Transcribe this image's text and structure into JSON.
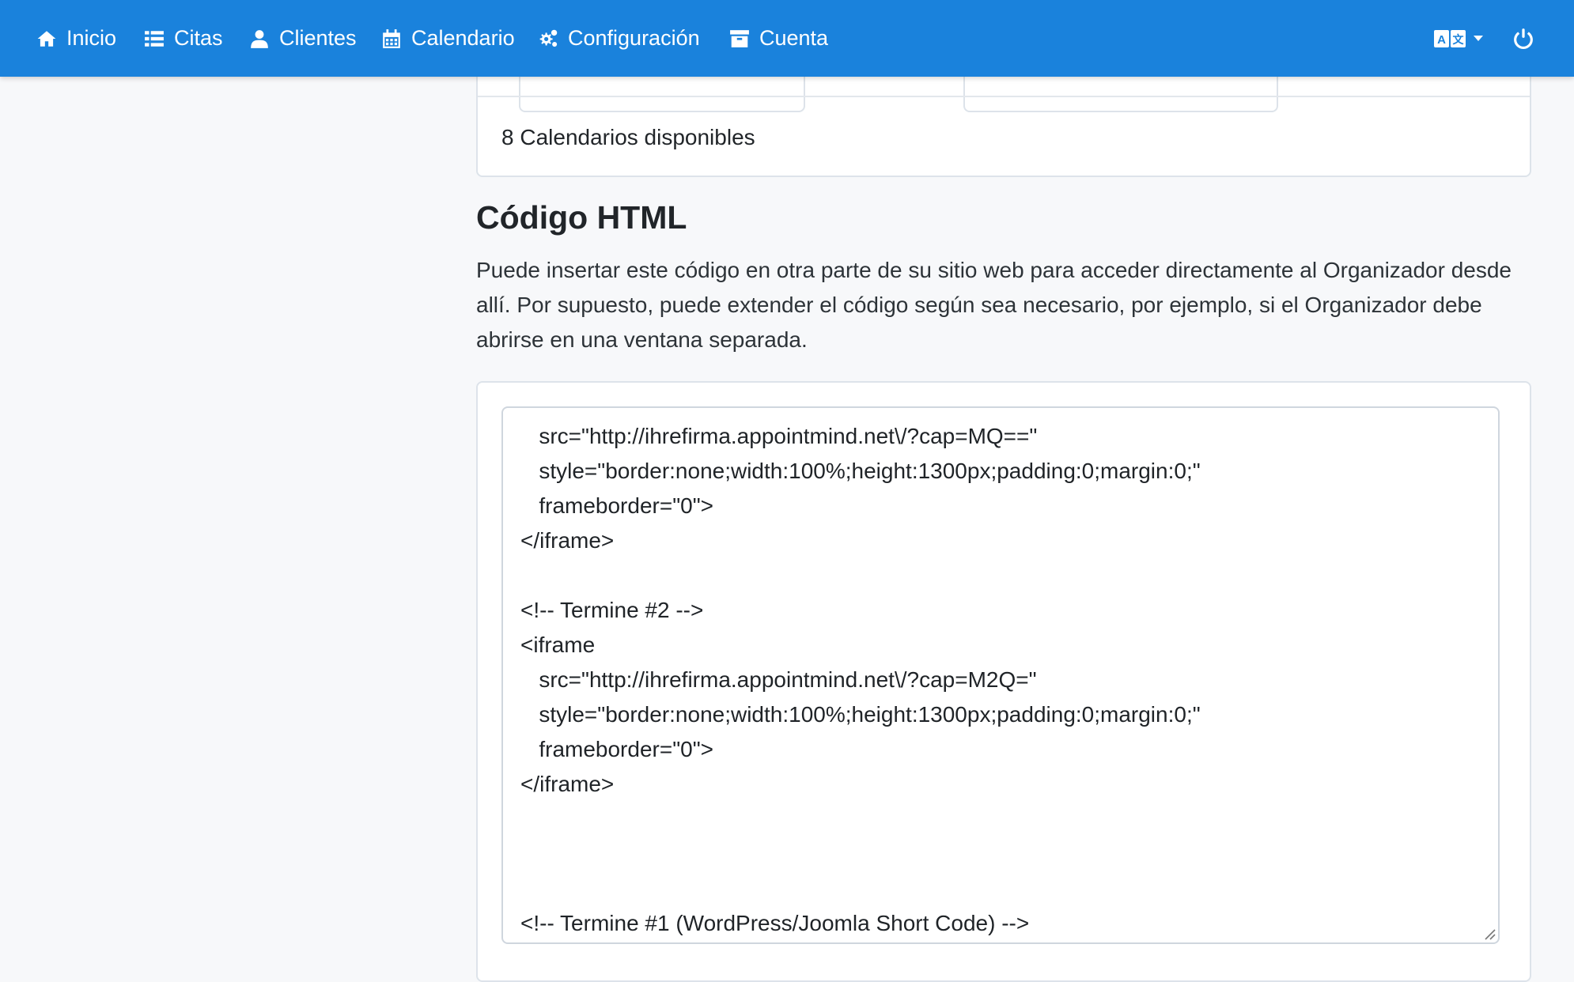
{
  "nav": {
    "items": [
      {
        "label": "Inicio",
        "icon": "home-icon"
      },
      {
        "label": "Citas",
        "icon": "list-icon"
      },
      {
        "label": "Clientes",
        "icon": "user-icon"
      },
      {
        "label": "Calendario",
        "icon": "calendar-icon"
      },
      {
        "label": "Configuración",
        "icon": "gears-icon"
      },
      {
        "label": "Cuenta",
        "icon": "archive-icon"
      }
    ],
    "language_icon": "language-icon",
    "power_icon": "power-icon"
  },
  "calendars": {
    "footer": "8 Calendarios disponibles"
  },
  "html_code": {
    "title": "Código HTML",
    "description": "Puede insertar este código en otra parte de su sitio web para acceder directamente al Organizador desde allí. Por supuesto, puede extender el código según sea necesario, por ejemplo, si el Organizador debe abrirse en una ventana separada.",
    "lines": [
      "   src=\"http://ihrefirma.appointmind.net\\/?cap=MQ==\"",
      "   style=\"border:none;width:100%;height:1300px;padding:0;margin:0;\"",
      "   frameborder=\"0\">",
      "</iframe>",
      "",
      "<!-- Termine #2 -->",
      "<iframe",
      "   src=\"http://ihrefirma.appointmind.net\\/?cap=M2Q=\"",
      "   style=\"border:none;width:100%;height:1300px;padding:0;margin:0;\"",
      "   frameborder=\"0\">",
      "</iframe>",
      "",
      "",
      "",
      "<!-- Termine #1 (WordPress/Joomla Short Code) -->"
    ]
  },
  "colors": {
    "navbar": "#1a82dc",
    "page_bg": "#f7f8fa"
  }
}
